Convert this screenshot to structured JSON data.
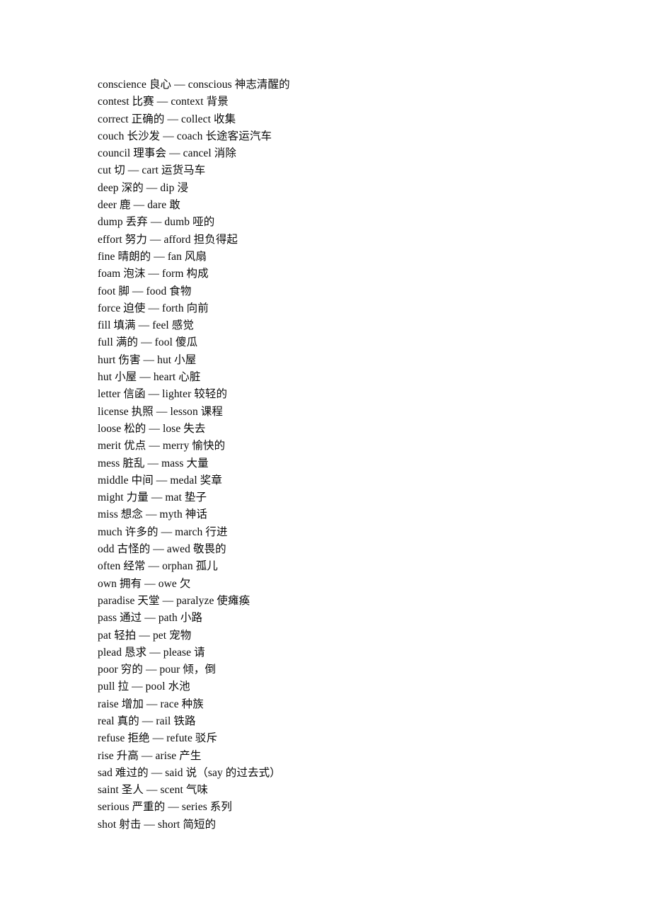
{
  "document": {
    "type": "vocabulary-list",
    "page_background": "#ffffff",
    "text_color": "#0a0a0a",
    "separator": "—",
    "description": "List of commonly confused English word pairs with Chinese glosses"
  },
  "entries": [
    {
      "line": "conscience 良心 — conscious 神志清醒的"
    },
    {
      "line": "contest 比赛 — context 背景"
    },
    {
      "line": "correct 正确的 — collect 收集"
    },
    {
      "line": "couch 长沙发 — coach 长途客运汽车"
    },
    {
      "line": "council 理事会 — cancel 消除"
    },
    {
      "line": "cut 切 — cart 运货马车"
    },
    {
      "line": "deep 深的 — dip 浸"
    },
    {
      "line": "deer 鹿 — dare 敢"
    },
    {
      "line": "dump 丢弃 — dumb 哑的"
    },
    {
      "line": "effort 努力 — afford 担负得起"
    },
    {
      "line": "fine 晴朗的 — fan 风扇"
    },
    {
      "line": "foam 泡沫 — form 构成"
    },
    {
      "line": "foot 脚 — food 食物"
    },
    {
      "line": "force 迫使 — forth 向前"
    },
    {
      "line": "fill 填满 — feel 感觉"
    },
    {
      "line": "full 满的 — fool 傻瓜"
    },
    {
      "line": "hurt 伤害 — hut 小屋"
    },
    {
      "line": "hut 小屋 — heart 心脏"
    },
    {
      "line": "letter 信函 — lighter 较轻的"
    },
    {
      "line": "license 执照 — lesson 课程"
    },
    {
      "line": "loose 松的 — lose 失去"
    },
    {
      "line": "merit 优点 — merry 愉快的"
    },
    {
      "line": "mess 脏乱 — mass 大量"
    },
    {
      "line": "middle 中间 — medal 奖章"
    },
    {
      "line": "might 力量 — mat 垫子"
    },
    {
      "line": "miss 想念 — myth 神话"
    },
    {
      "line": "much 许多的 — march 行进"
    },
    {
      "line": "odd 古怪的 — awed 敬畏的"
    },
    {
      "line": "often 经常 — orphan 孤儿"
    },
    {
      "line": "own 拥有 — owe 欠"
    },
    {
      "line": "paradise 天堂 — paralyze 使瘫痪"
    },
    {
      "line": "pass 通过 — path 小路"
    },
    {
      "line": "pat 轻拍 — pet 宠物"
    },
    {
      "line": "plead 恳求 — please 请"
    },
    {
      "line": "poor 穷的 — pour 倾，倒"
    },
    {
      "line": "pull 拉 — pool 水池"
    },
    {
      "line": "raise 增加 — race 种族"
    },
    {
      "line": "real 真的 — rail 铁路"
    },
    {
      "line": "refuse 拒绝 — refute 驳斥"
    },
    {
      "line": "rise 升高 — arise 产生"
    },
    {
      "line": "sad 难过的 — said 说（say 的过去式）"
    },
    {
      "line": "saint 圣人 — scent 气味"
    },
    {
      "line": "serious 严重的 — series 系列"
    },
    {
      "line": "shot 射击 — short 简短的"
    }
  ]
}
